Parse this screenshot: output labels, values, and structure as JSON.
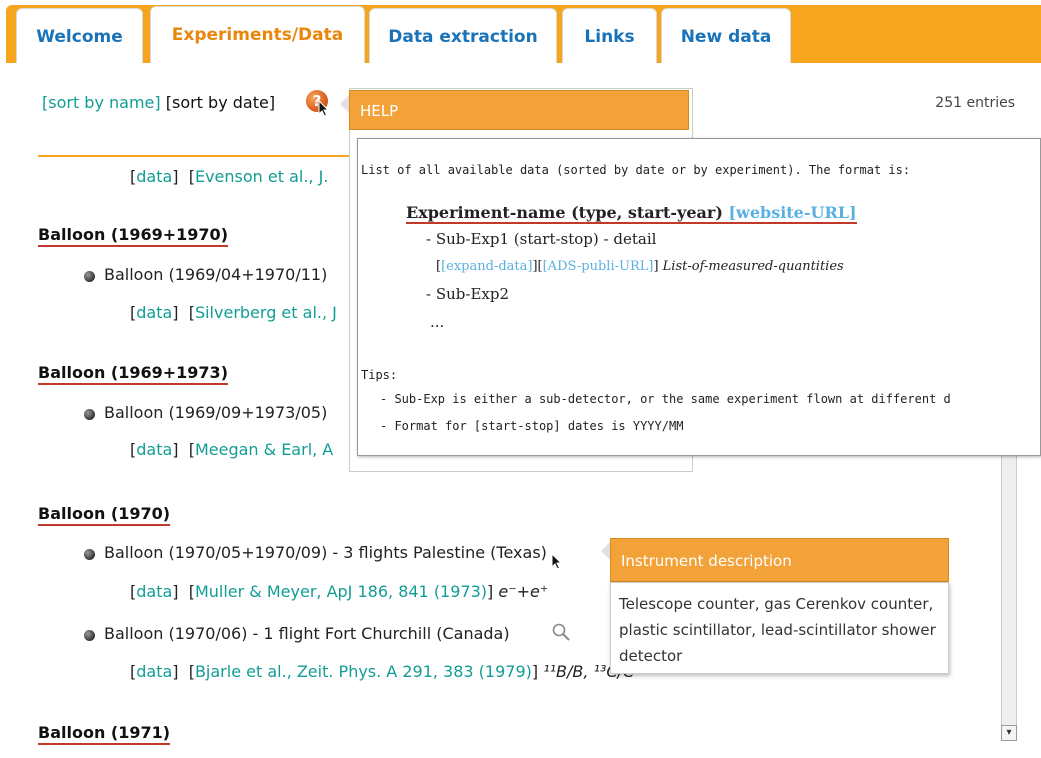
{
  "tabs": [
    "Welcome",
    "Experiments/Data",
    "Data extraction",
    "Links",
    "New data"
  ],
  "sort": {
    "by_name": "[sort by name]",
    "by_date": "[sort by date]"
  },
  "entries_count": "251 entries",
  "help": {
    "title": "HELP",
    "intro": "List of all available data (sorted by date or by experiment). The format is:",
    "format_title": "Experiment-name (type, start-year)",
    "format_website": "[website-URL]",
    "sub1": "- Sub-Exp1 (start-stop) - detail",
    "expand": "[expand-data]",
    "ads": "[ADS-publi-URL]",
    "quantities": "List-of-measured-quantities",
    "sub2": "- Sub-Exp2",
    "dots": "...",
    "tips_label": "Tips:",
    "tip1": "- Sub-Exp is either a sub-detector, or the same experiment flown at different d",
    "tip2": "- Format for [start-stop] dates is YYYY/MM"
  },
  "list": {
    "partial": {
      "data": "data",
      "ref": "Evenson et al., J."
    },
    "groups": [
      {
        "title": "Balloon (1969+1970)",
        "item": "Balloon (1969/04+1970/11)",
        "data": "data",
        "ref": "Silverberg et al., J"
      },
      {
        "title": "Balloon (1969+1973)",
        "item": "Balloon (1969/09+1973/05)",
        "data": "data",
        "ref": "Meegan & Earl, A"
      },
      {
        "title": "Balloon (1970)",
        "item": "Balloon (1970/05+1970/09) - 3 flights Palestine (Texas)",
        "data": "data",
        "ref": "Muller & Meyer, ApJ 186, 841 (1973)",
        "qty": "e⁻+e⁺",
        "item2": "Balloon (1970/06) - 1 flight Fort Churchill (Canada)",
        "data2": "data",
        "ref2": "Bjarle et al., Zeit. Phys. A 291, 383 (1979)",
        "qty2": "¹¹B/B, ¹³C/C"
      },
      {
        "title": "Balloon (1971)"
      }
    ]
  },
  "instrument": {
    "title": "Instrument description",
    "body": "Telescope counter, gas Cerenkov counter, plastic scintillator, lead-scintillator shower detector"
  },
  "colors": {
    "accent": "#f7a51d",
    "link": "#129d94",
    "tab_text": "#1a73b8"
  }
}
